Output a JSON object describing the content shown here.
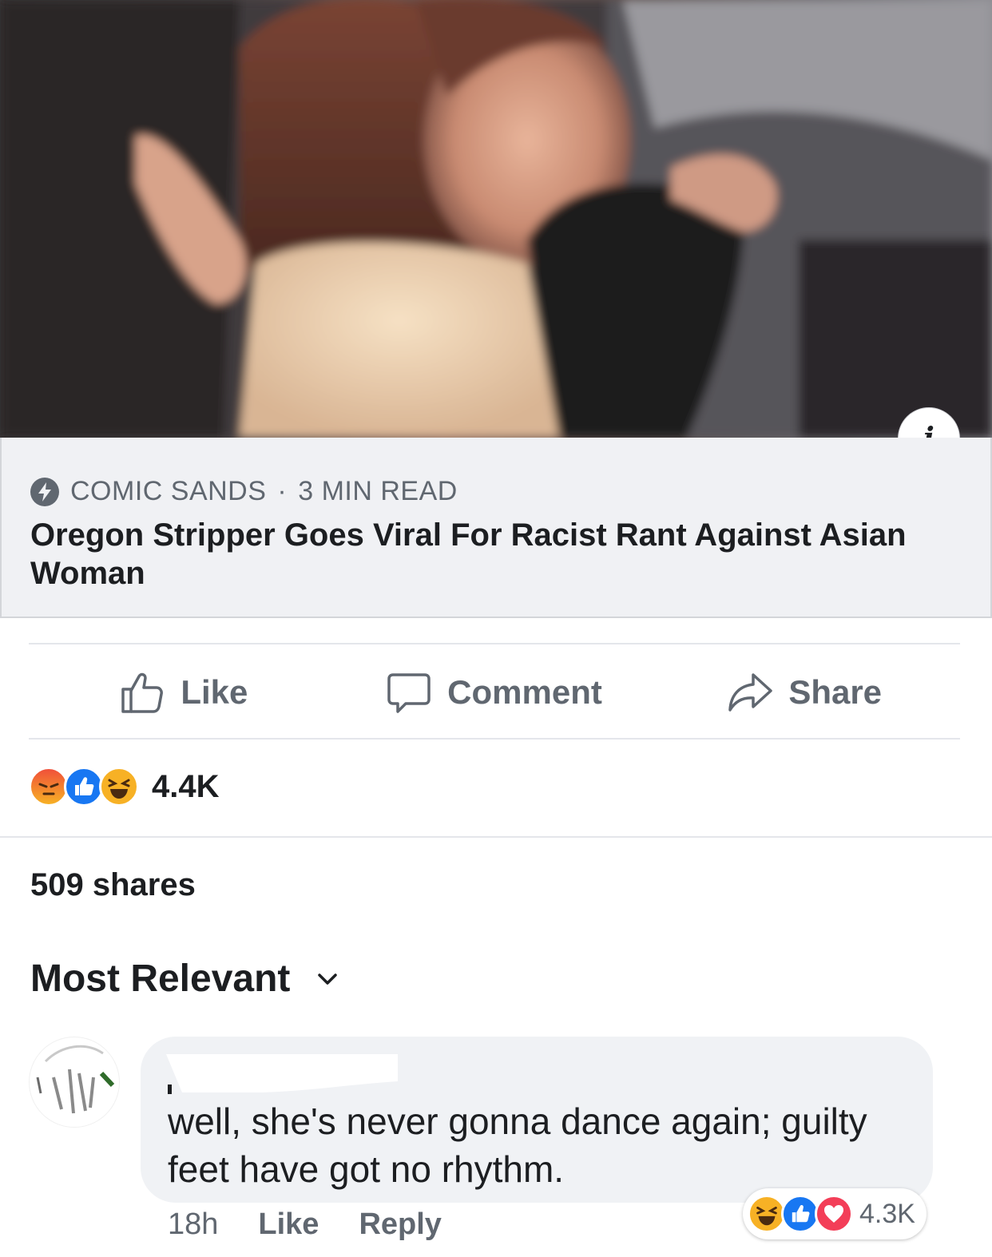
{
  "hero": {
    "image": "blurred-video-still-woman-in-car",
    "info_icon": "info-icon",
    "info_glyph": "i"
  },
  "link_card": {
    "source_icon": "bolt-icon",
    "source": "COMIC SANDS",
    "separator": "·",
    "read_time": "3 MIN READ",
    "headline": "Oregon Stripper Goes Viral For Racist Rant Against Asian Woman"
  },
  "actions": {
    "like": "Like",
    "comment": "Comment",
    "share": "Share"
  },
  "reactions": {
    "icons": [
      "angry-reaction-icon",
      "like-reaction-icon",
      "haha-reaction-icon"
    ],
    "count": "4.4K"
  },
  "shares": "509 shares",
  "sort": {
    "label": "Most Relevant",
    "icon": "chevron-down-icon"
  },
  "comment": {
    "author_redacted": true,
    "text": "well, she's never gonna dance again; guilty feet have got no rhythm.",
    "time": "18h",
    "like": "Like",
    "reply": "Reply",
    "reaction_icons": [
      "haha-reaction-icon",
      "like-reaction-icon",
      "love-reaction-icon"
    ],
    "reaction_count": "4.3K"
  },
  "colors": {
    "card_bg": "#f0f1f4",
    "muted_text": "#606770",
    "like_blue": "#1877f2",
    "love_red": "#f33e58",
    "angry_red": "#e9710f",
    "haha_yellow": "#f7b125"
  }
}
